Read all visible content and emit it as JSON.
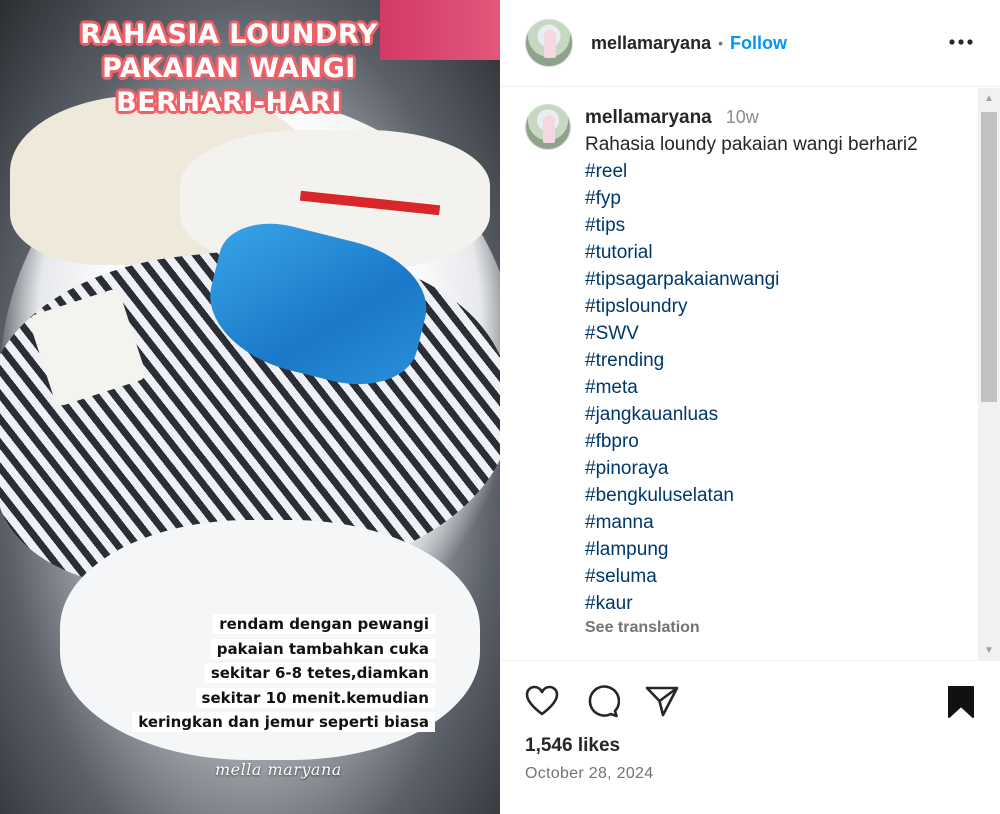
{
  "media": {
    "title": [
      "RAHASIA LOUNDRY",
      "PAKAIAN WANGI",
      "BERHARI-HARI"
    ],
    "caption_lines": [
      "rendam dengan pewangi",
      "pakaian tambahkan cuka",
      "sekitar 6-8 tetes,diamkan",
      "sekitar 10 menit.kemudian",
      "keringkan dan jemur seperti biasa"
    ],
    "watermark": "mella maryana"
  },
  "header": {
    "username": "mellamaryana",
    "separator": "•",
    "follow_label": "Follow"
  },
  "post": {
    "username": "mellamaryana",
    "time_ago": "10w",
    "text": "Rahasia loundy pakaian wangi berhari2",
    "hashtags": [
      "#reel",
      "#fyp",
      "#tips",
      "#tutorial",
      "#tipsagarpakaianwangi",
      "#tipsloundry",
      "#SWV",
      "#trending",
      "#meta",
      "#jangkauanluas",
      "#fbpro",
      "#pinoraya",
      "#bengkuluselatan",
      "#manna",
      "#lampung",
      "#seluma",
      "#kaur"
    ],
    "see_translation": "See translation"
  },
  "actions": {
    "likes": "1,546 likes",
    "date": "October 28, 2024"
  },
  "icons": {
    "more": "more-options-icon",
    "like": "heart-icon",
    "comment": "comment-icon",
    "share": "send-icon",
    "save": "bookmark-icon"
  },
  "colors": {
    "link": "#00376b",
    "follow": "#0095f6",
    "title_outline": "#f0616a"
  }
}
